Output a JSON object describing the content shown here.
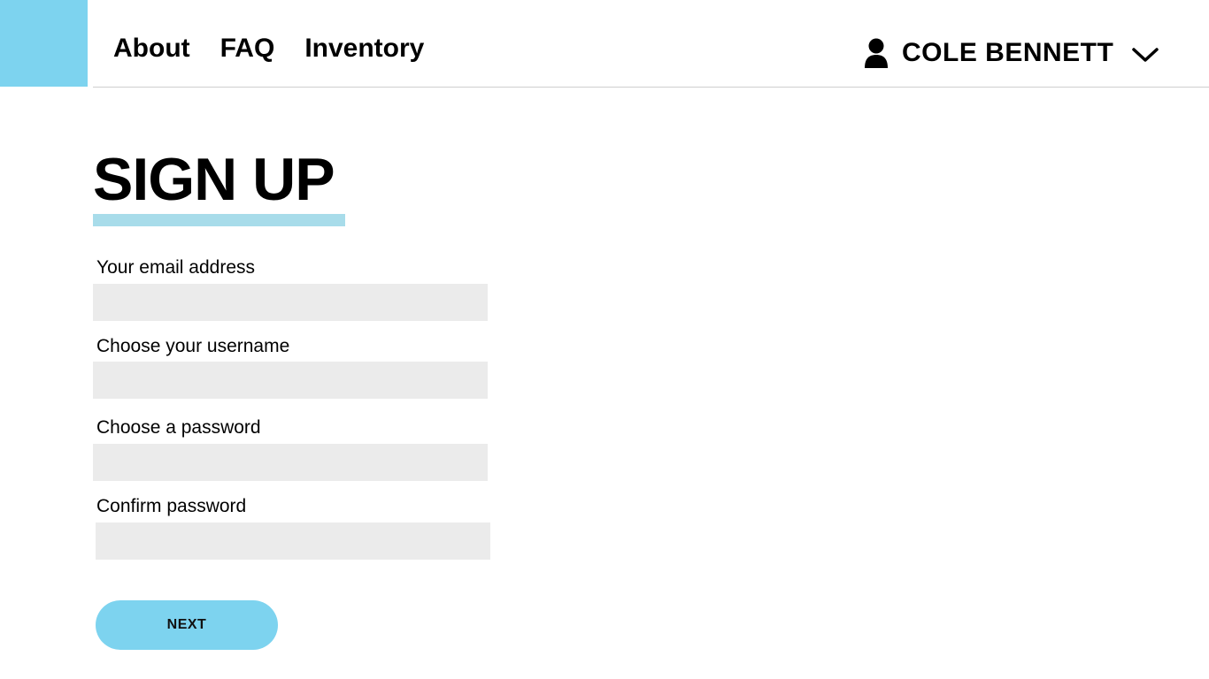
{
  "header": {
    "nav": [
      {
        "label": "About"
      },
      {
        "label": "FAQ"
      },
      {
        "label": "Inventory"
      }
    ],
    "user": {
      "name": "COLE BENNETT",
      "icon": "user-icon",
      "menu_icon": "chevron-down-icon"
    }
  },
  "main": {
    "title": "SIGN UP",
    "fields": [
      {
        "label": "Your email address",
        "value": "",
        "placeholder": ""
      },
      {
        "label": "Choose your username",
        "value": "",
        "placeholder": ""
      },
      {
        "label": "Choose a password",
        "value": "",
        "placeholder": ""
      },
      {
        "label": "Confirm password",
        "value": "",
        "placeholder": ""
      }
    ],
    "next_label": "NEXT"
  },
  "colors": {
    "accent": "#7dd3ef",
    "underline": "#a8dcea",
    "input_bg": "#ebebeb"
  }
}
